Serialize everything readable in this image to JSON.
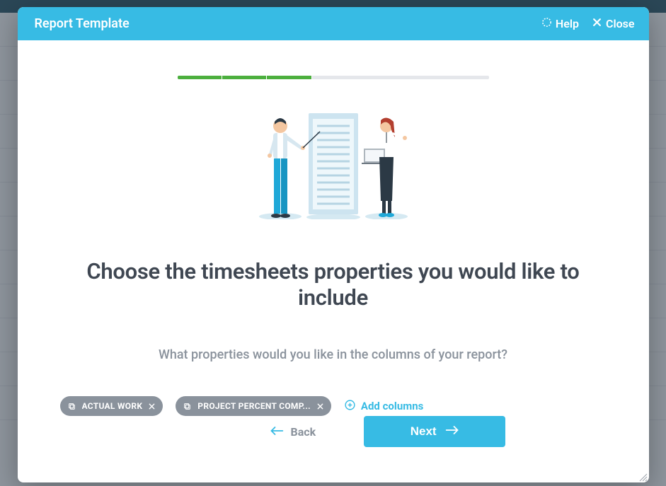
{
  "header": {
    "title": "Report Template",
    "help": "Help",
    "close": "Close"
  },
  "progress": {
    "steps": 7,
    "completed": 3
  },
  "content": {
    "heading": "Choose the timesheets properties you would like to include",
    "subtext": "What properties would you like in the columns of your report?"
  },
  "chips": [
    {
      "label": "ACTUAL WORK"
    },
    {
      "label": "PROJECT PERCENT COMP..."
    }
  ],
  "add_columns": "Add columns",
  "buttons": {
    "back": "Back",
    "next": "Next"
  }
}
